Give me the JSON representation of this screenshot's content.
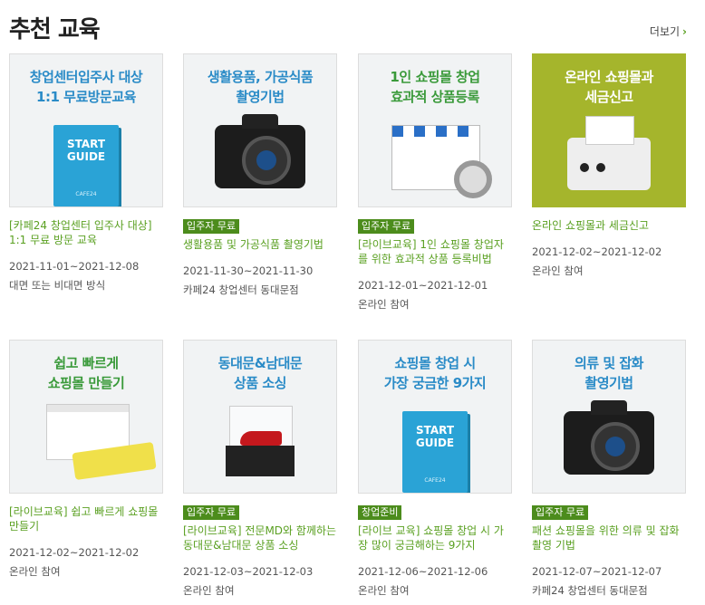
{
  "header": {
    "title": "추천 교육",
    "more": "더보기",
    "more_icon": "chevron-right-icon"
  },
  "colors": {
    "accent": "#5aa021",
    "badge": "#4c8c1c",
    "caption_blue": "#2a8bc7",
    "tile_green": "#a5b52c"
  },
  "cards": [
    {
      "thumb_caption": [
        "창업센터입주사 대상",
        "1:1 무료방문교육"
      ],
      "book_title": [
        "START",
        "GUIDE"
      ],
      "book_logo": "CAFE24",
      "badge": "",
      "name": "[카페24 창업센터 입주사 대상] 1:1 무료 방문 교육",
      "date": "2021-11-01~2021-12-08",
      "place": "대면 또는 비대면 방식"
    },
    {
      "thumb_caption": [
        "생활용품, 가공식품",
        "촬영기법"
      ],
      "badge": "입주자 무료",
      "name": "생활용품 및 가공식품 촬영기법",
      "date": "2021-11-30~2021-11-30",
      "place": "카페24 창업센터 동대문점"
    },
    {
      "thumb_caption": [
        "1인 쇼핑몰 창업",
        "효과적 상품등록"
      ],
      "badge": "입주자 무료",
      "name": "[라이브교육] 1인 쇼핑몰 창업자를 위한 효과적 상품 등록비법",
      "date": "2021-12-01~2021-12-01",
      "place": "온라인 참여"
    },
    {
      "thumb_caption": [
        "온라인 쇼핑몰과",
        "세금신고"
      ],
      "badge": "",
      "name": "온라인 쇼핑몰과 세금신고",
      "date": "2021-12-02~2021-12-02",
      "place": "온라인 참여"
    },
    {
      "thumb_caption": [
        "쉽고 빠르게",
        "쇼핑몰 만들기"
      ],
      "badge": "",
      "name": "[라이브교육] 쉽고 빠르게 쇼핑몰 만들기",
      "date": "2021-12-02~2021-12-02",
      "place": "온라인 참여"
    },
    {
      "thumb_caption": [
        "동대문&남대문",
        "상품 소싱"
      ],
      "badge": "입주자 무료",
      "name": "[라이브교육] 전문MD와 함께하는 동대문&남대문 상품 소싱",
      "date": "2021-12-03~2021-12-03",
      "place": "온라인 참여"
    },
    {
      "thumb_caption": [
        "쇼핑몰 창업 시",
        "가장 궁금한 9가지"
      ],
      "book_title": [
        "START",
        "GUIDE"
      ],
      "book_logo": "CAFE24",
      "badge": "창업준비",
      "name": "[라이브 교육] 쇼핑몰 창업 시 가장 많이 궁금해하는 9가지",
      "date": "2021-12-06~2021-12-06",
      "place": "온라인 참여"
    },
    {
      "thumb_caption": [
        "의류 및 잡화",
        "촬영기법"
      ],
      "badge": "입주자 무료",
      "name": "패션 쇼핑몰을 위한 의류 및 잡화 촬영 기법",
      "date": "2021-12-07~2021-12-07",
      "place": "카페24 창업센터 동대문점"
    }
  ]
}
